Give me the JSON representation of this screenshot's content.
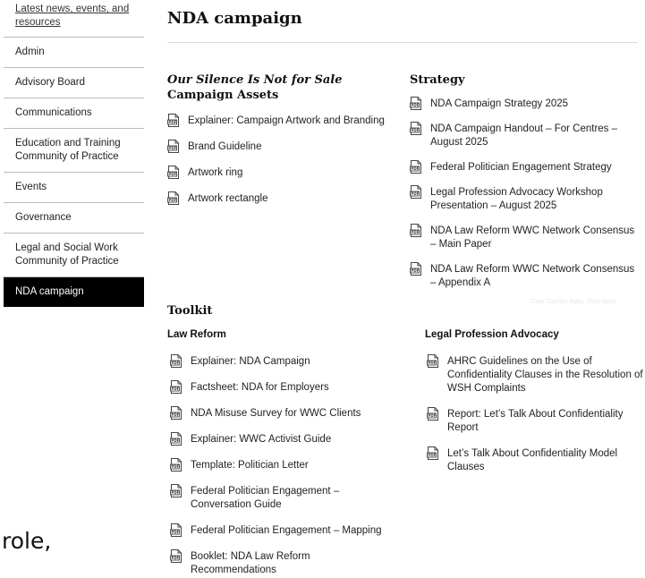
{
  "sidebar": {
    "items": [
      {
        "label": "Latest news, events, and resources"
      },
      {
        "label": "Admin"
      },
      {
        "label": "Advisory Board"
      },
      {
        "label": "Communications"
      },
      {
        "label": "Education and Training Community of Practice"
      },
      {
        "label": "Events"
      },
      {
        "label": "Governance"
      },
      {
        "label": "Legal and Social Work Community of Practice"
      },
      {
        "label": "NDA campaign"
      }
    ]
  },
  "stray_text": "role,",
  "page": {
    "title": "NDA campaign"
  },
  "assets": {
    "heading_italic": "Our Silence Is Not for Sale",
    "heading": "Campaign Assets",
    "items": [
      {
        "label": "Explainer: Campaign Artwork and Branding"
      },
      {
        "label": "Brand Guideline"
      },
      {
        "label": "Artwork ring"
      },
      {
        "label": "Artwork rectangle"
      }
    ]
  },
  "strategy": {
    "heading": "Strategy",
    "items": [
      {
        "label": "NDA Campaign Strategy 2025"
      },
      {
        "label": "NDA Campaign Handout – For Centres – August 2025"
      },
      {
        "label": "Federal Politician Engagement Strategy"
      },
      {
        "label": "Legal Profession Advocacy Workshop Presentation – August 2025"
      },
      {
        "label": "NDA Law Reform WWC Network Consensus – Main Paper"
      },
      {
        "label": "NDA Law Reform WWC Network Consensus – Appendix A"
      }
    ]
  },
  "faint_text": "Clear Caches  Bday, Thus Mark",
  "toolkit": {
    "heading": "Toolkit",
    "law_reform": {
      "heading": "Law Reform",
      "items": [
        {
          "label": "Explainer: NDA Campaign"
        },
        {
          "label": "Factsheet: NDA for Employers"
        },
        {
          "label": "NDA Misuse Survey for WWC Clients"
        },
        {
          "label": "Explainer: WWC Activist Guide"
        },
        {
          "label": "Template: Politician Letter"
        },
        {
          "label": "Federal Politician Engagement – Conversation Guide"
        },
        {
          "label": "Federal Politician Engagement – Mapping"
        },
        {
          "label": "Booklet: NDA Law Reform Recommendations"
        }
      ]
    },
    "legal_advocacy": {
      "heading": "Legal Profession Advocacy",
      "items": [
        {
          "label": "AHRC Guidelines on the Use of Confidentiality Clauses in the Resolution of WSH Complaints"
        },
        {
          "label": "Report: Let’s Talk About Confidentiality Report"
        },
        {
          "label": "Let’s Talk About Confidentiality Model Clauses"
        }
      ]
    }
  },
  "icons": {
    "document": "pdf-file-icon"
  }
}
